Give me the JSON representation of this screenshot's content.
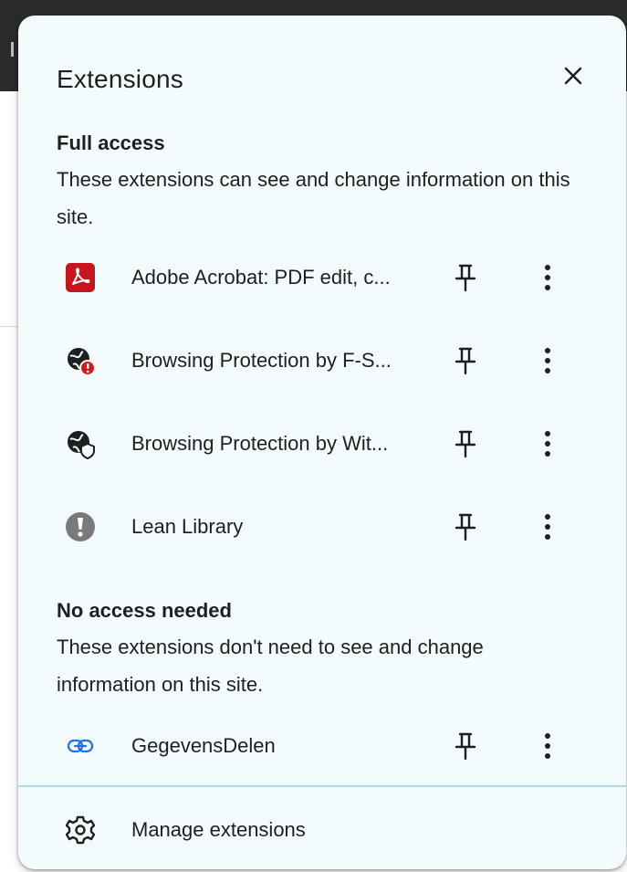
{
  "panel": {
    "title": "Extensions",
    "close_icon": "close-icon"
  },
  "full_access": {
    "title": "Full access",
    "description": "These extensions can see and change information on this site.",
    "items": [
      {
        "name": "Adobe Acrobat: PDF edit, c...",
        "icon": "adobe-acrobat-icon",
        "icon_color": "#c4161c"
      },
      {
        "name": "Browsing Protection by F-S...",
        "icon": "globe-alert-icon",
        "icon_color": "#d11a1a"
      },
      {
        "name": "Browsing Protection by Wit...",
        "icon": "globe-shield-icon",
        "icon_color": "#1f1f1f"
      },
      {
        "name": "Lean Library",
        "icon": "lean-library-icon",
        "icon_color": "#7a7a7a"
      }
    ]
  },
  "no_access": {
    "title": "No access needed",
    "description": "These extensions don't need to see and change information on this site.",
    "items": [
      {
        "name": "GegevensDelen",
        "icon": "link-icon",
        "icon_color": "#1a73e8"
      }
    ]
  },
  "footer": {
    "manage_label": "Manage extensions",
    "icon": "gear-icon"
  },
  "colors": {
    "panel_bg": "#f3fbfc",
    "divider": "#a9dde8",
    "text": "#1f1f1f"
  }
}
